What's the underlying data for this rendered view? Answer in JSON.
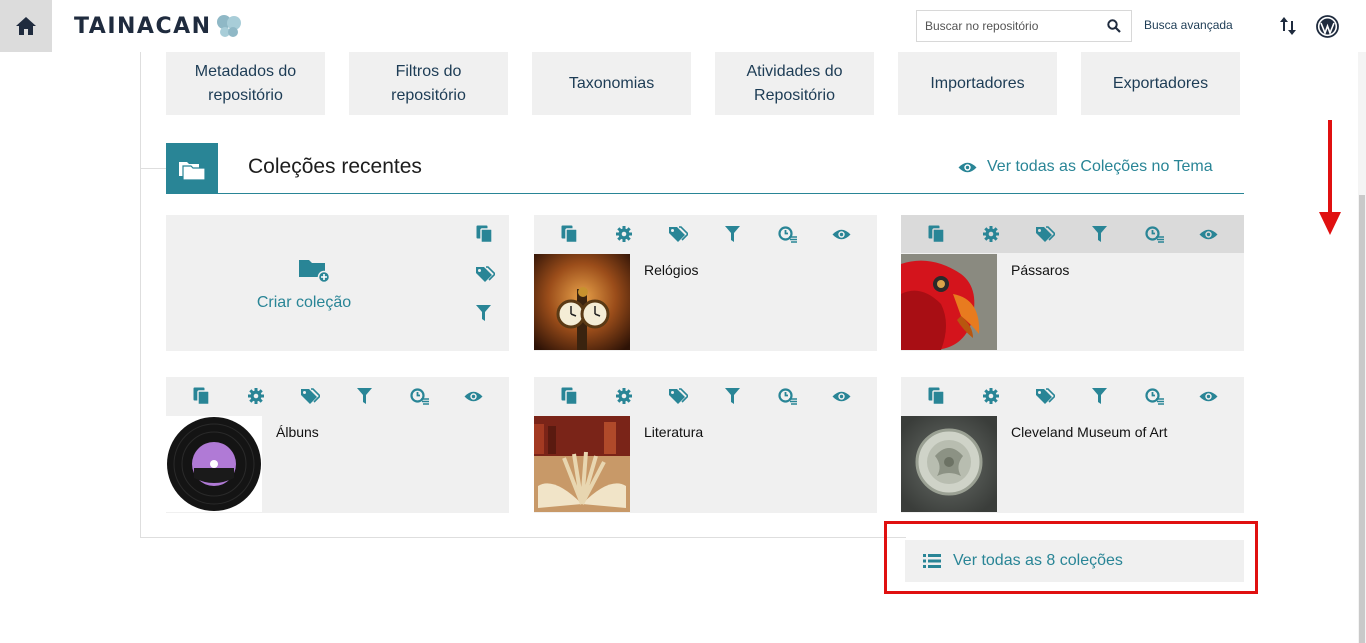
{
  "header": {
    "logo_text": "Tainacan",
    "search_placeholder": "Buscar no repositório",
    "advanced_search_label": "Busca avançada",
    "icons": [
      "home-icon",
      "search-icon",
      "sort-icon",
      "wordpress-icon"
    ]
  },
  "repo_nav": [
    {
      "label": "Metadados do repositório"
    },
    {
      "label": "Filtros do repositório"
    },
    {
      "label": "Taxonomias"
    },
    {
      "label": "Atividades do Repositório"
    },
    {
      "label": "Importadores"
    },
    {
      "label": "Exportadores"
    }
  ],
  "recent": {
    "title": "Coleções recentes",
    "see_all_theme": "Ver todas as Coleções no Tema",
    "create_label": "Criar coleção",
    "collections": [
      {
        "name": "Relógios"
      },
      {
        "name": "Pássaros"
      },
      {
        "name": "Álbuns"
      },
      {
        "name": "Literatura"
      },
      {
        "name": "Cleveland Museum of Art"
      }
    ],
    "view_all_label": "Ver todas as 8 coleções"
  },
  "colors": {
    "accent": "#298596",
    "dark_text": "#1d3c55",
    "card_bg": "#f0f0f0",
    "annotation_red": "#e01010"
  }
}
